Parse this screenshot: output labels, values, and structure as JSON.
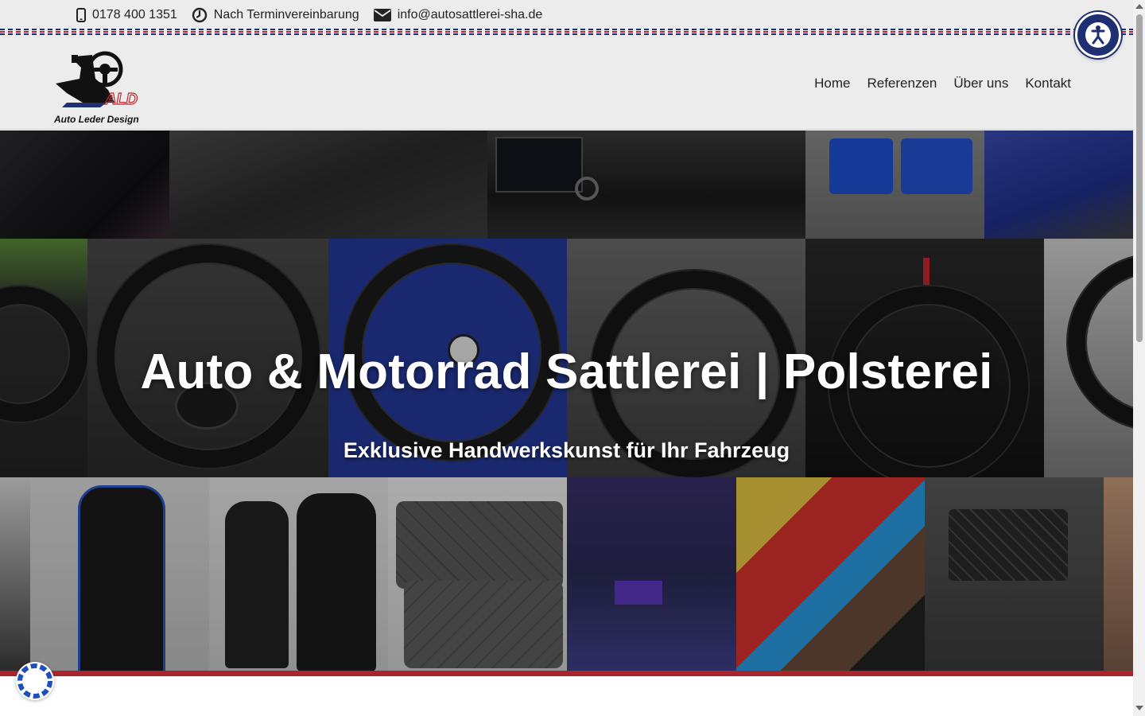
{
  "topbar": {
    "phone": "0178 400 1351",
    "hours": "Nach Terminvereinbarung",
    "email": "info@autosattlerei-sha.de",
    "icons": [
      "mobile-phone-icon",
      "clock-icon",
      "envelope-icon"
    ]
  },
  "header": {
    "logo_text": "Auto Leder Design",
    "logo_mark": "ALD",
    "nav": [
      "Home",
      "Referenzen",
      "Über uns",
      "Kontakt"
    ]
  },
  "hero": {
    "title": "Auto & Motorrad Sattlerei | Polsterei",
    "subtitle": "Exklusive Handwerkskunst für Ihr Fahrzeug"
  },
  "colors": {
    "brand_navy": "#1f2f73",
    "brand_red": "#a8262b",
    "background": "#ececec"
  },
  "widgets": {
    "accessibility_icon": "accessibility-icon",
    "cookie_icon": "cookie-settings-icon"
  }
}
